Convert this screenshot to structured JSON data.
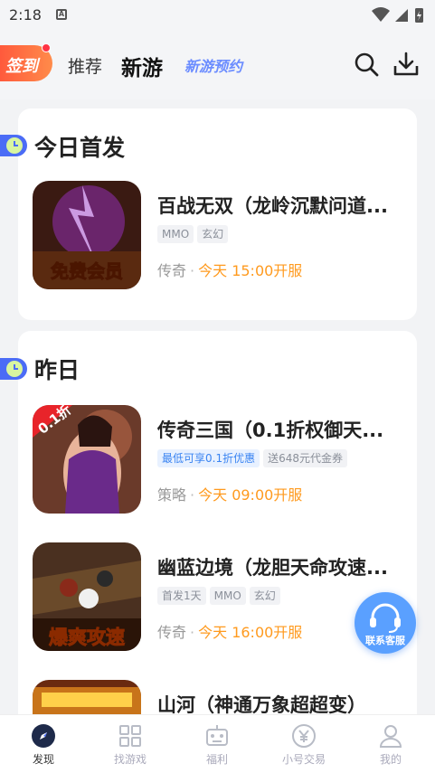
{
  "status_bar": {
    "time": "2:18",
    "app_icon_letter": "A"
  },
  "header": {
    "signin_label": "签到",
    "tabs": [
      {
        "label": "推荐"
      },
      {
        "label": "新游"
      },
      {
        "label": "新游预约"
      }
    ],
    "icons": [
      "search-icon",
      "download-icon"
    ]
  },
  "sections": [
    {
      "title": "今日首发",
      "games": [
        {
          "name": "百战无双（龙岭沉默问道...",
          "tags": [
            "MMO",
            "玄幻"
          ],
          "category": "传奇",
          "time": "今天 15:00开服",
          "thumb_label": "免费会员"
        }
      ]
    },
    {
      "title": "昨日",
      "games": [
        {
          "name": "传奇三国（0.1折权御天...",
          "tags": [
            "最低可享0.1折优惠",
            "送648元代金券"
          ],
          "category": "策略",
          "time": "今天 09:00开服",
          "thumb_badge": "0.1折"
        },
        {
          "name": "幽蓝边境（龙胆天命攻速...",
          "tags": [
            "首发1天",
            "MMO",
            "玄幻"
          ],
          "category": "传奇",
          "time": "今天 16:00开服",
          "thumb_label": "爆爽攻速"
        },
        {
          "name": "山河（神通万象超超变）",
          "tags": [],
          "category": "",
          "time": ""
        }
      ]
    }
  ],
  "meta_separator": "·",
  "customer_service": {
    "label": "联系客服"
  },
  "tabbar": {
    "items": [
      {
        "label": "发现",
        "icon": "compass-icon"
      },
      {
        "label": "找游戏",
        "icon": "grid-icon"
      },
      {
        "label": "福利",
        "icon": "gift-robot-icon"
      },
      {
        "label": "小号交易",
        "icon": "yen-exchange-icon"
      },
      {
        "label": "我的",
        "icon": "user-icon"
      }
    ]
  },
  "colors": {
    "accent_orange": "#ff9a1e",
    "brand_blue": "#3a84f2",
    "signin_red": "#ff5a3c"
  }
}
